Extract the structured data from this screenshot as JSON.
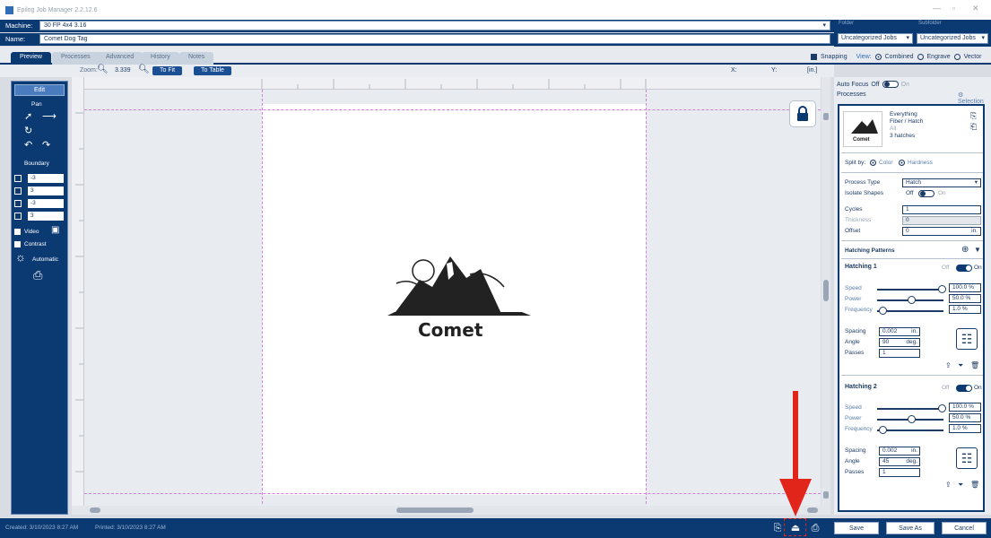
{
  "window": {
    "title": "Epilog Job Manager 2.2.12.6"
  },
  "machine": {
    "label": "Machine:",
    "value": "30 FP 4x4 3.16"
  },
  "name": {
    "label": "Name:",
    "value": "Comet Dog Tag"
  },
  "folder": {
    "caption": "Folder",
    "value": "Uncategorized Jobs"
  },
  "subfolder": {
    "caption": "Subfolder",
    "value": "Uncategorized Jobs"
  },
  "tabs": [
    {
      "label": "Preview"
    },
    {
      "label": "Processes"
    },
    {
      "label": "Advanced"
    },
    {
      "label": "History"
    },
    {
      "label": "Notes"
    }
  ],
  "view": {
    "snapping": "Snapping",
    "label": "View:",
    "combined": "Combined",
    "engrave": "Engrave",
    "vector": "Vector"
  },
  "zoom": {
    "label": "Zoom:",
    "value": "3.339",
    "fit": "To Fit",
    "table": "To Table"
  },
  "coords": {
    "x": "X:",
    "y": "Y:",
    "units": "[in.]"
  },
  "left": {
    "edit": "Edit",
    "pan": "Pan",
    "boundary": "Boundary",
    "b1": "-3",
    "b2": "3",
    "b3": "-3",
    "b4": "3",
    "video": "Video",
    "contrast": "Contrast",
    "automatic": "Automatic"
  },
  "artwork": {
    "text": "Comet"
  },
  "right": {
    "autofocus": "Auto Focus",
    "off": "Off",
    "on": "On",
    "processes": "Processes",
    "selection": "Selection",
    "proc_name": "Everything",
    "proc_type": "Fiber / Hatch",
    "proc_all": "All",
    "proc_count": "3 hatches",
    "thumb_text": "Comet",
    "split_by": "Split by:",
    "color": "Color",
    "hardness": "Hardness",
    "process_type_label": "Process Type",
    "process_type_value": "Hatch",
    "isolate": "Isolate Shapes",
    "cycles_label": "Cycles",
    "cycles": "1",
    "thickness_label": "Thickness",
    "thickness": "0",
    "offset_label": "Offset",
    "offset": "0",
    "offset_unit": "in.",
    "patterns": "Hatching Patterns",
    "h1": {
      "title": "Hatching 1",
      "speed": "100.0",
      "power": "50.0",
      "frequency": "1.0",
      "spacing": "0.002",
      "angle": "90",
      "passes": "1"
    },
    "h2": {
      "title": "Hatching 2",
      "speed": "100.0",
      "power": "50.0",
      "frequency": "1.0",
      "spacing": "0.002",
      "angle": "45",
      "passes": "1"
    },
    "speed_label": "Speed",
    "power_label": "Power",
    "frequency_label": "Frequency",
    "spacing_label": "Spacing",
    "angle_label": "Angle",
    "passes_label": "Passes",
    "pct": "%",
    "in": "in.",
    "deg": "deg."
  },
  "status": {
    "created": "Created: 3/10/2023 8:27 AM",
    "printed": "Printed: 3/10/2023 8:27 AM",
    "save": "Save",
    "save_as": "Save As",
    "cancel": "Cancel"
  },
  "colors": {
    "navy": "#0b3a73",
    "accent": "#e1251b",
    "guide": "#d27fd8"
  }
}
